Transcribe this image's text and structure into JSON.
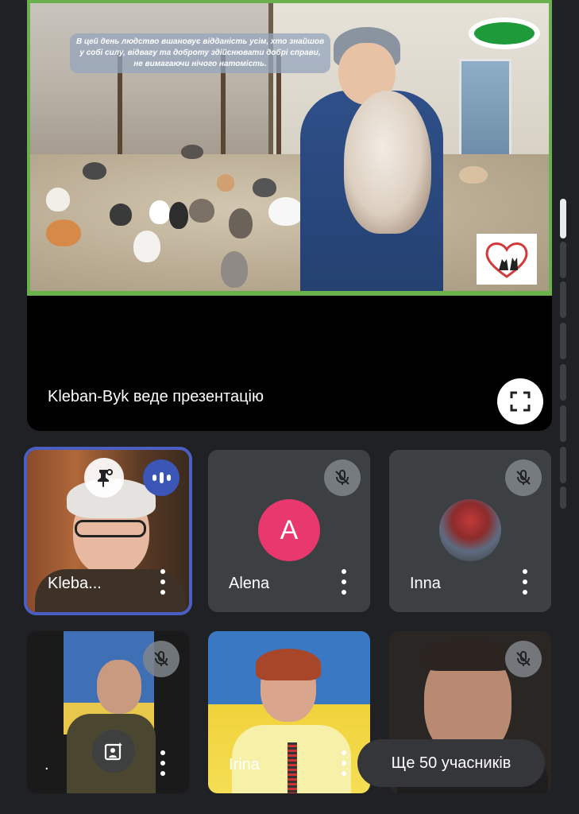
{
  "presentation": {
    "slide_quote": "В цей день людство вшановує відданість усім, хто знайшов у собі силу, відвагу та доброту здійснювати добрі справи, не вимагаючи нічого натомість.",
    "presenter_label": "Kleban-Byk веде презентацію",
    "fullscreen_icon": "fullscreen-icon"
  },
  "participants": [
    {
      "name": "Kleba...",
      "state": "speaking",
      "pinned": true
    },
    {
      "name": "Alena",
      "avatar_letter": "A",
      "avatar_color": "#e8386d",
      "muted": true
    },
    {
      "name": "Inna",
      "muted": true
    },
    {
      "name": ".",
      "muted": true
    },
    {
      "name": "Irina"
    },
    {
      "name": "",
      "muted": true
    }
  ],
  "more_participants_label": "Ще 50 учасників",
  "colors": {
    "background": "#202124",
    "tile": "#3c4043",
    "active_outline": "#4a5fc1",
    "slide_border": "#6ab04c"
  }
}
